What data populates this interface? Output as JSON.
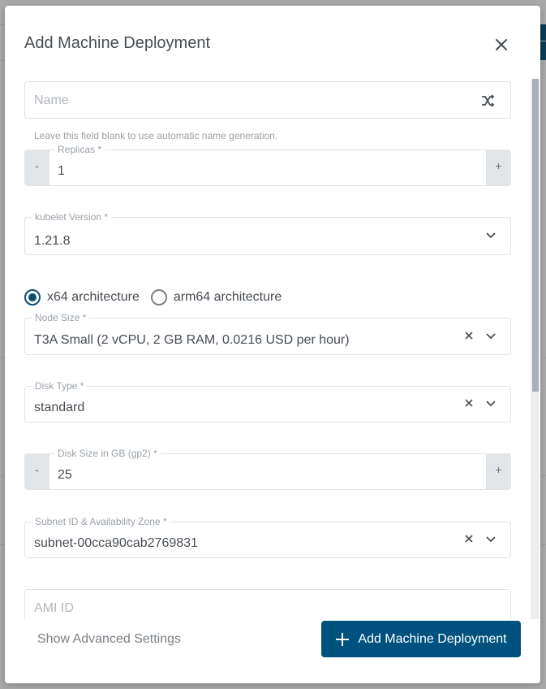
{
  "dialog": {
    "title": "Add Machine Deployment",
    "close_icon": "close-icon"
  },
  "form": {
    "name": {
      "placeholder": "Name",
      "value": "",
      "hint": "Leave this field blank to use automatic name generation.",
      "action_icon": "shuffle-icon"
    },
    "replicas": {
      "label": "Replicas *",
      "value": "1",
      "decrement_label": "-",
      "increment_label": "+"
    },
    "kubelet_version": {
      "label": "kubelet Version *",
      "value": "1.21.8",
      "icon": "chevron-down-icon"
    },
    "architecture": {
      "options": [
        {
          "label": "x64 architecture",
          "checked": true
        },
        {
          "label": "arm64 architecture",
          "checked": false
        }
      ]
    },
    "node_size": {
      "label": "Node Size *",
      "value": "T3A Small (2 vCPU, 2 GB RAM, 0.0216 USD per hour)"
    },
    "disk_type": {
      "label": "Disk Type *",
      "value": "standard"
    },
    "disk_size": {
      "label": "Disk Size in GB (gp2) *",
      "value": "25",
      "decrement_label": "-",
      "increment_label": "+"
    },
    "subnet": {
      "label": "Subnet ID & Availability Zone *",
      "value": "subnet-00cca90cab2769831"
    },
    "ami_id": {
      "placeholder": "AMI ID",
      "value": ""
    }
  },
  "footer": {
    "advanced_label": "Show Advanced Settings",
    "submit_label": "Add Machine Deployment"
  },
  "colors": {
    "primary": "#00527e",
    "radio_checked": "#0c4d74",
    "overlay": "#a9a9a9"
  }
}
